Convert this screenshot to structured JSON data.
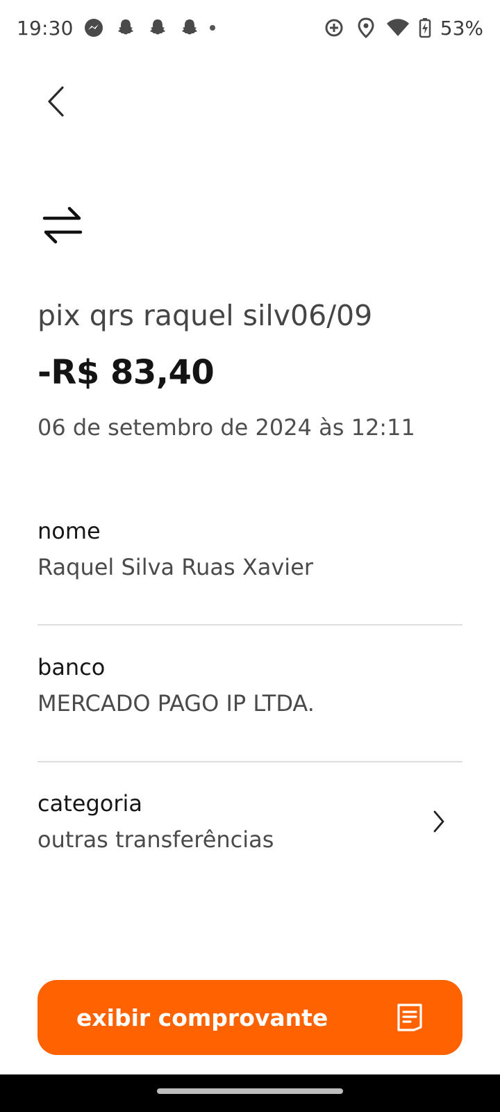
{
  "status_bar": {
    "time": "19:30",
    "battery": "53%",
    "left_icons": [
      "messenger-icon",
      "snapchat-icon",
      "snapchat-icon",
      "snapchat-icon",
      "dot-icon"
    ],
    "right_icons": [
      "data-saver-icon",
      "location-icon",
      "wifi-icon",
      "battery-charging-icon"
    ]
  },
  "transaction": {
    "title": "pix qrs raquel silv06/09",
    "amount": "-R$ 83,40",
    "date": "06 de setembro de 2024 às 12:11"
  },
  "details": {
    "name": {
      "label": "nome",
      "value": "Raquel Silva Ruas Xavier"
    },
    "bank": {
      "label": "banco",
      "value": "MERCADO PAGO IP LTDA."
    },
    "category": {
      "label": "categoria",
      "value": "outras transferências"
    }
  },
  "cta": {
    "label": "exibir comprovante"
  },
  "colors": {
    "accent": "#ff6200",
    "text_primary": "#141414",
    "text_secondary": "#4a4a4a",
    "divider": "#dedede"
  }
}
